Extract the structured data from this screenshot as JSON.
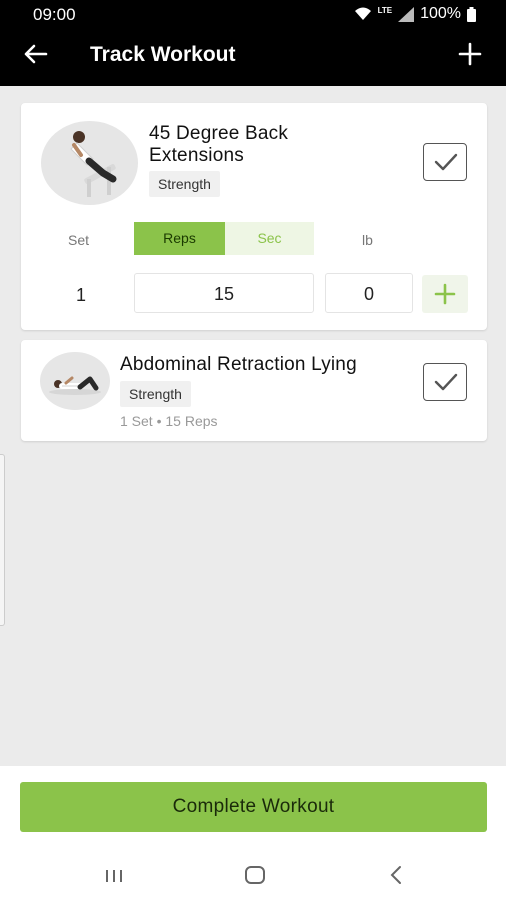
{
  "status": {
    "time": "09:00",
    "network": "LTE",
    "battery": "100%"
  },
  "app_bar": {
    "title": "Track Workout",
    "back_icon": "arrow-left-icon",
    "add_icon": "plus-icon"
  },
  "exercises": [
    {
      "name": "45 Degree Back Extensions",
      "category": "Strength",
      "columns": {
        "set": "Set",
        "reps": "Reps",
        "sec": "Sec",
        "unit": "lb"
      },
      "row": {
        "set": "1",
        "reps": "15",
        "weight": "0"
      }
    },
    {
      "name": "Abdominal Retraction Lying",
      "category": "Strength",
      "summary": "1 Set • 15 Reps"
    }
  ],
  "footer": {
    "complete_label": "Complete Workout"
  },
  "colors": {
    "accent": "#8bc34a",
    "accent_light": "#eef6e4",
    "header_bg": "#000000",
    "page_bg": "#ebebeb"
  }
}
